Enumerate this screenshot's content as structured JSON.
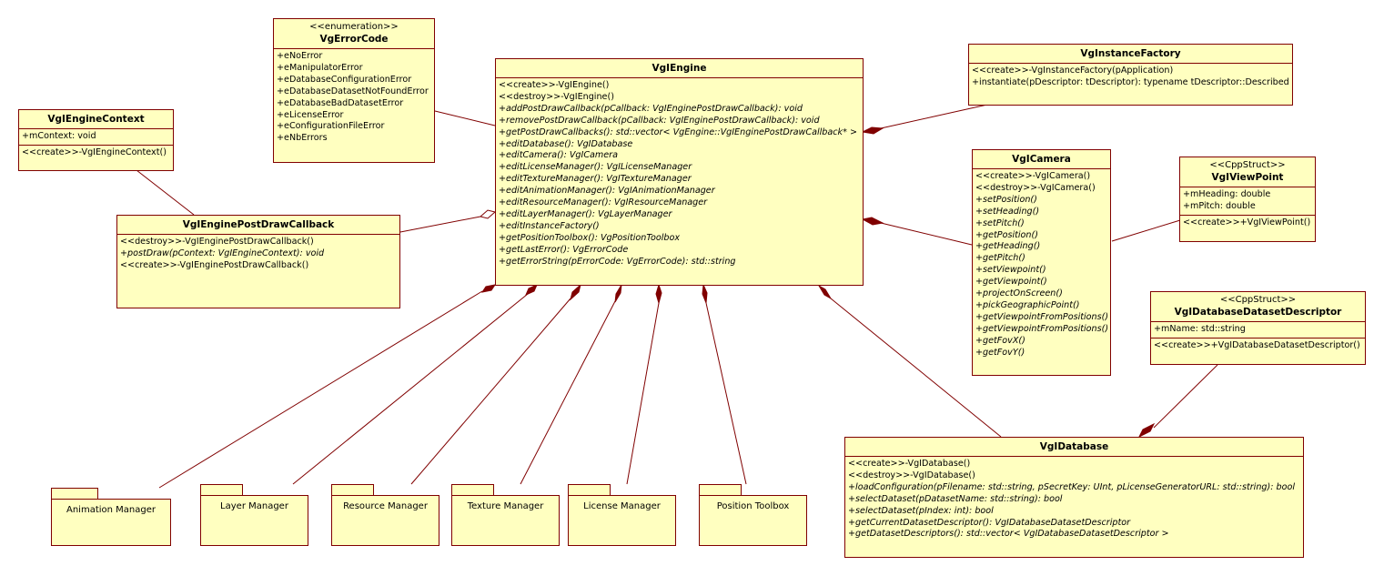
{
  "diagram": {
    "type": "UML class diagram",
    "colors": {
      "fill": "#ffffc0",
      "stroke": "#800000"
    }
  },
  "classes": {
    "engine_context": {
      "name": "VgIEngineContext",
      "attributes": [
        "+mContext: void"
      ],
      "operations": [
        "<<create>>-VgIEngineContext()"
      ]
    },
    "error_code": {
      "stereotype": "<<enumeration>>",
      "name": "VgErrorCode",
      "literals": [
        "+eNoError",
        "+eManipulatorError",
        "+eDatabaseConfigurationError",
        "+eDatabaseDatasetNotFoundError",
        "+eDatabaseBadDatasetError",
        "+eLicenseError",
        "+eConfigurationFileError",
        "+eNbErrors"
      ]
    },
    "engine": {
      "name": "VgIEngine",
      "operations": [
        "<<create>>-VgIEngine()",
        "<<destroy>>-VgIEngine()",
        "+addPostDrawCallback(pCallback: VgIEnginePostDrawCallback): void",
        "+removePostDrawCallback(pCallback: VgIEnginePostDrawCallback): void",
        "+getPostDrawCallbacks(): std::vector< VgEngine::VgIEnginePostDrawCallback* >",
        "+editDatabase(): VgIDatabase",
        "+editCamera(): VgICamera",
        "+editLicenseManager(): VgILicenseManager",
        "+editTextureManager(): VgITextureManager",
        "+editAnimationManager(): VgIAnimationManager",
        "+editResourceManager(): VgIResourceManager",
        "+editLayerManager(): VgLayerManager",
        "+editInstanceFactory()",
        "+getPositionToolbox(): VgPositionToolbox",
        "+getLastError(): VgErrorCode",
        "+getErrorString(pErrorCode: VgErrorCode): std::string"
      ]
    },
    "post_draw_callback": {
      "name": "VgIEnginePostDrawCallback",
      "operations": [
        "<<destroy>>-VgIEnginePostDrawCallback()",
        "+postDraw(pContext: VgIEngineContext): void",
        "<<create>>-VgIEnginePostDrawCallback()"
      ]
    },
    "instance_factory": {
      "name": "VgInstanceFactory",
      "operations": [
        "<<create>>-VgInstanceFactory(pApplication)",
        "+instantiate(pDescriptor: tDescriptor): typename tDescriptor::Described"
      ]
    },
    "camera": {
      "name": "VgICamera",
      "operations": [
        "<<create>>-VgICamera()",
        "<<destroy>>-VgICamera()",
        "+setPosition()",
        "+setHeading()",
        "+setPitch()",
        "+getPosition()",
        "+getHeading()",
        "+getPitch()",
        "+setViewpoint()",
        "+getViewpoint()",
        "+projectOnScreen()",
        "+pickGeographicPoint()",
        "+getViewpointFromPositions()",
        "+getViewpointFromPositions()",
        "+getFovX()",
        "+getFovY()"
      ]
    },
    "view_point": {
      "stereotype": "<<CppStruct>>",
      "name": "VgIViewPoint",
      "attributes": [
        "+mHeading: double",
        "+mPitch: double"
      ],
      "operations": [
        "<<create>>+VgIViewPoint()"
      ]
    },
    "dataset_descriptor": {
      "stereotype": "<<CppStruct>>",
      "name": "VgIDatabaseDatasetDescriptor",
      "attributes": [
        "+mName: std::string"
      ],
      "operations": [
        "<<create>>+VgIDatabaseDatasetDescriptor()"
      ]
    },
    "database": {
      "name": "VgIDatabase",
      "operations": [
        "<<create>>-VgIDatabase()",
        "<<destroy>>-VgIDatabase()",
        "+loadConfiguration(pFilename: std::string, pSecretKey: UInt, pLicenseGeneratorURL: std::string): bool",
        "+selectDataset(pDatasetName: std::string): bool",
        "+selectDataset(pIndex: int): bool",
        "+getCurrentDatasetDescriptor(): VgIDatabaseDatasetDescriptor",
        "+getDatasetDescriptors(): std::vector< VgIDatabaseDatasetDescriptor >"
      ]
    }
  },
  "packages": [
    "Animation Manager",
    "Layer Manager",
    "Resource Manager",
    "Texture Manager",
    "License Manager",
    "Position Toolbox"
  ],
  "relationships": [
    {
      "from": "VgIEngine",
      "to": "VgInstanceFactory",
      "kind": "composition"
    },
    {
      "from": "VgIEngine",
      "to": "VgICamera",
      "kind": "composition"
    },
    {
      "from": "VgIEngine",
      "to": "VgIEnginePostDrawCallback",
      "kind": "aggregation"
    },
    {
      "from": "VgIEngine",
      "to": "VgErrorCode",
      "kind": "association"
    },
    {
      "from": "VgIEngineContext",
      "to": "VgIEnginePostDrawCallback",
      "kind": "association"
    },
    {
      "from": "VgICamera",
      "to": "VgIViewPoint",
      "kind": "association"
    },
    {
      "from": "VgIDatabase",
      "to": "VgIDatabaseDatasetDescriptor",
      "kind": "composition"
    },
    {
      "from": "VgIEngine",
      "to": "VgIDatabase",
      "kind": "composition"
    },
    {
      "from": "VgIEngine",
      "to": "Animation Manager",
      "kind": "composition"
    },
    {
      "from": "VgIEngine",
      "to": "Layer Manager",
      "kind": "composition"
    },
    {
      "from": "VgIEngine",
      "to": "Resource Manager",
      "kind": "composition"
    },
    {
      "from": "VgIEngine",
      "to": "Texture Manager",
      "kind": "composition"
    },
    {
      "from": "VgIEngine",
      "to": "License Manager",
      "kind": "composition"
    },
    {
      "from": "VgIEngine",
      "to": "Position Toolbox",
      "kind": "composition"
    }
  ]
}
